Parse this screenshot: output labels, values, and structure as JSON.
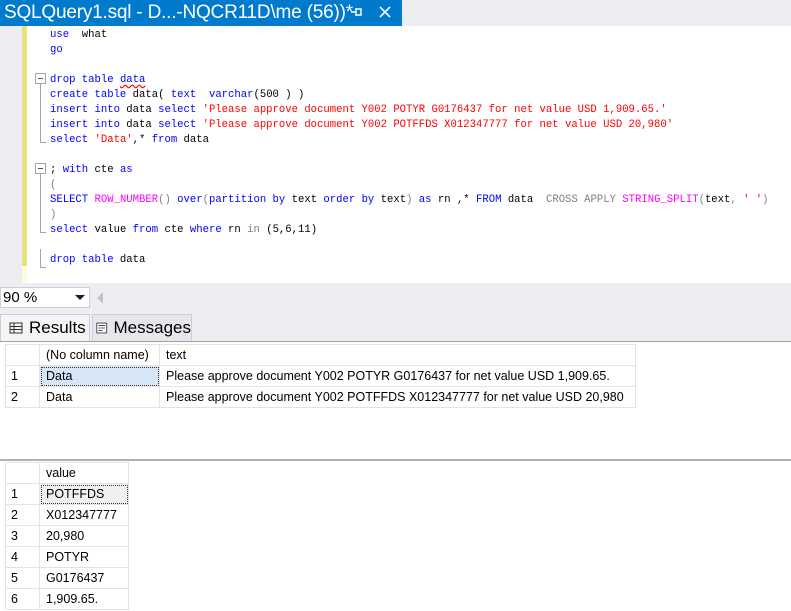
{
  "tab": {
    "title": "SQLQuery1.sql - D...-NQCR11D\\me (56))*"
  },
  "editor": {
    "lines": [
      {
        "id": "l1",
        "segments": [
          [
            "kw",
            "use"
          ],
          [
            "",
            "  "
          ],
          [
            "",
            "what"
          ]
        ]
      },
      {
        "id": "l2",
        "segments": [
          [
            "kw",
            "go"
          ]
        ]
      },
      {
        "id": "l3",
        "segments": []
      },
      {
        "id": "l4",
        "segments": [
          [
            "kw",
            "drop table "
          ],
          [
            "sq",
            "data"
          ]
        ]
      },
      {
        "id": "l5",
        "segments": [
          [
            "kw",
            "create table"
          ],
          [
            "",
            " data( "
          ],
          [
            "kw",
            "text"
          ],
          [
            "",
            "  "
          ],
          [
            "kw",
            "varchar"
          ],
          [
            "",
            "("
          ],
          [
            "",
            "500"
          ],
          [
            "",
            " ) )"
          ]
        ]
      },
      {
        "id": "l6",
        "segments": [
          [
            "kw",
            "insert into"
          ],
          [
            "",
            " data "
          ],
          [
            "kw",
            "select"
          ],
          [
            "str",
            " 'Please approve document Y002 POTYR G0176437 for net value USD 1,909.65.'"
          ]
        ]
      },
      {
        "id": "l7",
        "segments": [
          [
            "kw",
            "insert into"
          ],
          [
            "",
            " data "
          ],
          [
            "kw",
            "select"
          ],
          [
            "str",
            " 'Please approve document Y002 POTFFDS X012347777 for net value USD 20,980'"
          ]
        ]
      },
      {
        "id": "l8",
        "segments": [
          [
            "kw",
            "select"
          ],
          [
            "str",
            " 'Data'"
          ],
          [
            "",
            ","
          ],
          [
            "",
            "* "
          ],
          [
            "kw",
            "from"
          ],
          [
            "",
            " data"
          ]
        ]
      },
      {
        "id": "l9",
        "segments": []
      },
      {
        "id": "l10",
        "segments": [
          [
            "",
            ";"
          ],
          [
            "kw",
            " with"
          ],
          [
            "",
            " cte "
          ],
          [
            "kw",
            "as"
          ]
        ]
      },
      {
        "id": "l11",
        "segments": [
          [
            "gr",
            "("
          ]
        ]
      },
      {
        "id": "l12",
        "segments": [
          [
            "kw",
            "SELECT "
          ],
          [
            "fn",
            "ROW_NUMBER"
          ],
          [
            "gr",
            "()"
          ],
          [
            "kw",
            " over"
          ],
          [
            "gr",
            "("
          ],
          [
            "kw",
            "partition by"
          ],
          [
            "",
            " text "
          ],
          [
            "kw",
            "order by"
          ],
          [
            "",
            " text"
          ],
          [
            "gr",
            ")"
          ],
          [
            "kw",
            " as"
          ],
          [
            "",
            " rn ,* "
          ],
          [
            "kw",
            "FROM"
          ],
          [
            "",
            " data  "
          ],
          [
            "gr",
            "CROSS APPLY"
          ],
          [
            "fn",
            " STRING_SPLIT"
          ],
          [
            "gr",
            "("
          ],
          [
            "",
            "text"
          ],
          [
            "gr",
            ","
          ],
          [
            "str",
            " ' '"
          ],
          [
            "gr",
            ")"
          ]
        ]
      },
      {
        "id": "l13",
        "segments": [
          [
            "gr",
            ")"
          ]
        ]
      },
      {
        "id": "l14",
        "segments": [
          [
            "kw",
            "select"
          ],
          [
            "",
            " value "
          ],
          [
            "kw",
            "from"
          ],
          [
            "",
            " cte "
          ],
          [
            "kw",
            "where"
          ],
          [
            "",
            " rn "
          ],
          [
            "gr",
            "in"
          ],
          [
            "",
            " (5,6,11)"
          ]
        ]
      },
      {
        "id": "l15",
        "segments": []
      },
      {
        "id": "l16",
        "segments": [
          [
            "kw",
            "drop table"
          ],
          [
            "",
            " data"
          ]
        ]
      }
    ]
  },
  "zoom": {
    "value": "90 %"
  },
  "result_tabs": {
    "results": "Results",
    "messages": "Messages"
  },
  "grid1": {
    "headers": [
      "(No column name)",
      "text"
    ],
    "rows": [
      {
        "num": "1",
        "c1": "Data",
        "c2": "Please approve document Y002 POTYR G0176437 for net value USD 1,909.65."
      },
      {
        "num": "2",
        "c1": "Data",
        "c2": "Please approve document Y002 POTFFDS X012347777 for net value USD 20,980"
      }
    ]
  },
  "grid2": {
    "headers": [
      "value"
    ],
    "rows": [
      {
        "num": "1",
        "c1": "POTFFDS"
      },
      {
        "num": "2",
        "c1": "X012347777"
      },
      {
        "num": "3",
        "c1": "20,980"
      },
      {
        "num": "4",
        "c1": "POTYR"
      },
      {
        "num": "5",
        "c1": "G0176437"
      },
      {
        "num": "6",
        "c1": "1,909.65."
      }
    ]
  },
  "colors": {
    "tab_accent": "#007acc",
    "keyword": "#0000ff",
    "string": "#ff0000",
    "function": "#ff00ff",
    "operator": "#808080"
  }
}
